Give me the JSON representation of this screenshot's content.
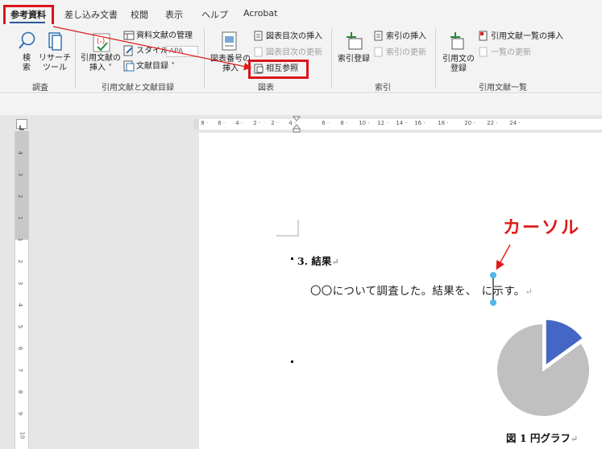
{
  "tabs": [
    {
      "label": "参考資料",
      "active": true
    },
    {
      "label": "差し込み文書"
    },
    {
      "label": "校閲"
    },
    {
      "label": "表示"
    },
    {
      "label": "ヘルプ"
    },
    {
      "label": "Acrobat"
    }
  ],
  "ribbon": {
    "research": {
      "search_label": "検\n索",
      "researcher_label": "リサーチ\nツール",
      "group_label": "調査"
    },
    "citations": {
      "insert_citation_label": "引用文献の\n挿入 ˅",
      "manage_sources_label": "資料文献の管理",
      "style_label": "スタイル:",
      "style_value": "APA",
      "bibliography_label": "文献目録 ˅",
      "group_label": "引用文献と文献目録"
    },
    "captions": {
      "insert_caption_label": "図表番号の\n挿入",
      "insert_table_of_figures_label": "図表目次の挿入",
      "update_table_label": "図表目次の更新",
      "cross_reference_label": "相互参照",
      "group_label": "図表"
    },
    "index": {
      "mark_entry_label": "索引登録",
      "insert_index_label": "索引の挿入",
      "update_index_label": "索引の更新",
      "group_label": "索引"
    },
    "authorities": {
      "mark_citation_label": "引用文の\n登録",
      "insert_table_label": "引用文献一覧の挿入",
      "update_table_label": "一覧の更新",
      "group_label": "引用文献一覧"
    }
  },
  "hruler_ticks": [
    "8",
    "6",
    "4",
    "2",
    "2",
    "4",
    "6",
    "8",
    "10",
    "12",
    "14",
    "16",
    "18",
    "20",
    "22",
    "24"
  ],
  "vruler_ticks": [
    "4",
    "3",
    "2",
    "1",
    "1",
    "2",
    "3",
    "4",
    "5",
    "6",
    "7",
    "8",
    "9",
    "10"
  ],
  "document": {
    "heading": "3. 結果",
    "body_before_cursor": "〇〇について調査した。結果を、",
    "body_after_cursor": "に示す。",
    "caption": "図 1 円グラフ",
    "para_mark": "↵"
  },
  "annotation": {
    "label": "カーソル"
  },
  "colors": {
    "accent_red": "#e01a1a",
    "tab_blue": "#2b579a",
    "pie_gray": "#c0c0c0",
    "pie_blue": "#4466c4",
    "cursor_blue": "#4fb8e8"
  },
  "chart_data": {
    "type": "pie",
    "values": [
      85,
      15
    ],
    "colors": [
      "#c0c0c0",
      "#4466c4"
    ]
  }
}
